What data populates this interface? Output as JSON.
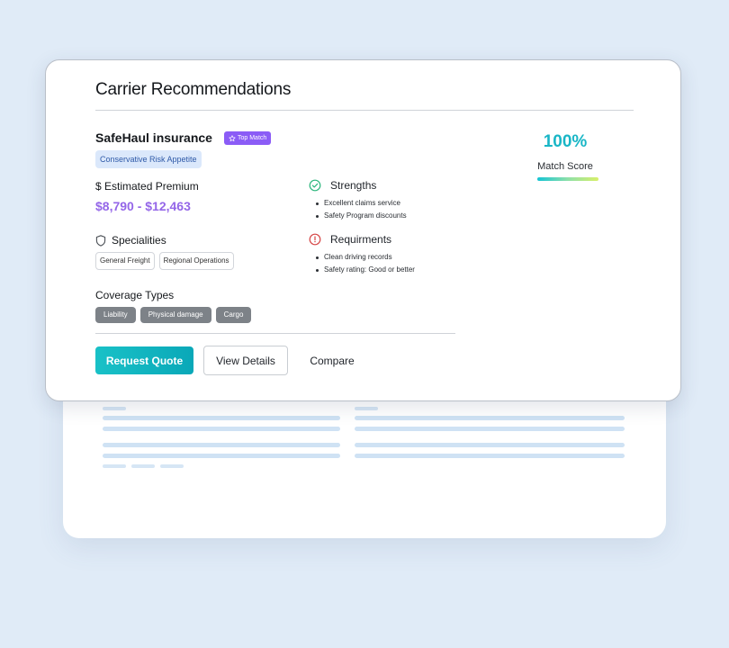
{
  "card": {
    "title": "Carrier Recommendations",
    "carrier_name": "SafeHaul insurance",
    "badge_label": "Top Match",
    "risk_appetite": "Conservative Risk Appetite",
    "premium_label": "$ Estimated Premium",
    "premium_range": "$8,790 - $12,463",
    "specialities": {
      "heading": "Specialities",
      "tags": [
        "General Freight",
        "Regional Operations"
      ]
    },
    "coverage": {
      "heading": "Coverage Types",
      "tags": [
        "Liability",
        "Physical damage",
        "Cargo"
      ]
    },
    "strengths": {
      "heading": "Strengths",
      "items": [
        "Excellent claims service",
        "Safety Program discounts"
      ]
    },
    "requirements": {
      "heading": "Requirments",
      "items": [
        "Clean driving records",
        "Safety rating: Good or better"
      ]
    },
    "match": {
      "value": "100%",
      "label": "Match Score",
      "fraction": 1.0
    },
    "actions": {
      "request_quote": "Request Quote",
      "view_details": "View Details",
      "compare": "Compare"
    }
  },
  "icons": {
    "badge": "star-icon",
    "specialities": "shield-icon",
    "strengths": "check-circle-icon",
    "requirements": "info-circle-icon"
  },
  "colors": {
    "accent_teal": "#19b6c6",
    "premium_purple": "#9466e8",
    "badge_purple": "#8b5cf6",
    "strength_green": "#2cb67d",
    "requirement_red": "#d64545"
  }
}
